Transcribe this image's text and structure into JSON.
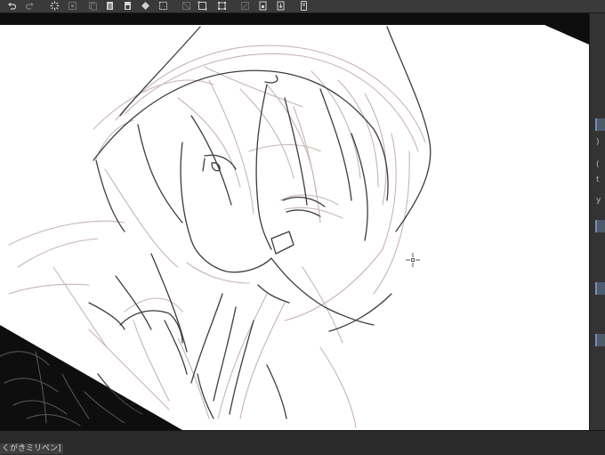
{
  "app": {
    "accent": "#7a8fb0",
    "canvas_bg": "#ffffff",
    "sketch_colors": {
      "line": "#3c3c3c",
      "rough": "#c9b4b4"
    }
  },
  "toolbar": {
    "buttons": [
      {
        "name": "undo-button",
        "icon": "undo-icon"
      },
      {
        "name": "redo-button",
        "icon": "redo-icon"
      },
      {
        "name": "loading-button",
        "icon": "spinner-icon"
      },
      {
        "name": "transform-button",
        "icon": "transform-icon"
      },
      {
        "name": "layer-copy-button",
        "icon": "layer-copy-icon"
      },
      {
        "name": "layer-paste-button",
        "icon": "layer-paste-icon"
      },
      {
        "name": "fill-button",
        "icon": "fill-icon"
      },
      {
        "name": "crop-button",
        "icon": "crop-icon"
      },
      {
        "name": "ruler-button",
        "icon": "ruler-icon"
      },
      {
        "name": "select-all-button",
        "icon": "select-all-icon"
      },
      {
        "name": "select-transform-button",
        "icon": "select-transform-icon"
      },
      {
        "name": "pen-button",
        "icon": "pen-icon"
      },
      {
        "name": "save-button",
        "icon": "save-icon"
      },
      {
        "name": "export-button",
        "icon": "export-icon"
      },
      {
        "name": "device-button",
        "icon": "device-icon"
      }
    ]
  },
  "status": {
    "brush_name": "くがきミリペン]"
  }
}
